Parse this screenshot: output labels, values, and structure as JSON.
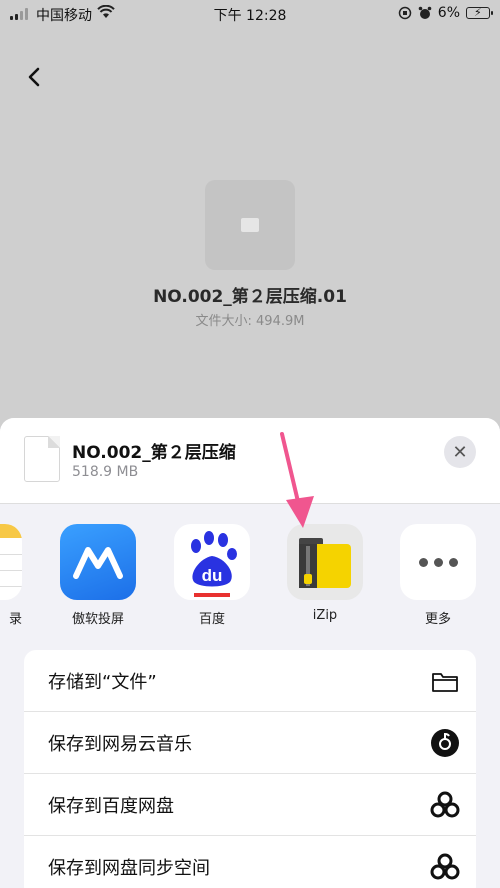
{
  "status_bar": {
    "carrier": "中国移动",
    "time": "下午 12:28",
    "battery": "6%"
  },
  "preview": {
    "file_name": "NO.002_第２层压缩.01",
    "file_size": "文件大小: 494.9M"
  },
  "share_sheet": {
    "title": "NO.002_第２层压缩",
    "size": "518.9 MB",
    "apps": [
      {
        "label": "录",
        "icon": "notes-icon"
      },
      {
        "label": "傲软投屏",
        "icon": "apowermirror-icon"
      },
      {
        "label": "百度",
        "icon": "baidu-icon"
      },
      {
        "label": "iZip",
        "icon": "izip-icon"
      },
      {
        "label": "更多",
        "icon": "more-icon"
      }
    ],
    "actions": [
      {
        "label": "存储到“文件”",
        "icon": "folder-icon"
      },
      {
        "label": "保存到网易云音乐",
        "icon": "netease-music-icon"
      },
      {
        "label": "保存到百度网盘",
        "icon": "baidu-netdisk-icon"
      },
      {
        "label": "保存到网盘同步空间",
        "icon": "netdisk-sync-icon"
      }
    ]
  },
  "colors": {
    "accent_pink": "#f0568f",
    "izip_yellow": "#f5d300",
    "baidu_blue": "#2932e1"
  }
}
